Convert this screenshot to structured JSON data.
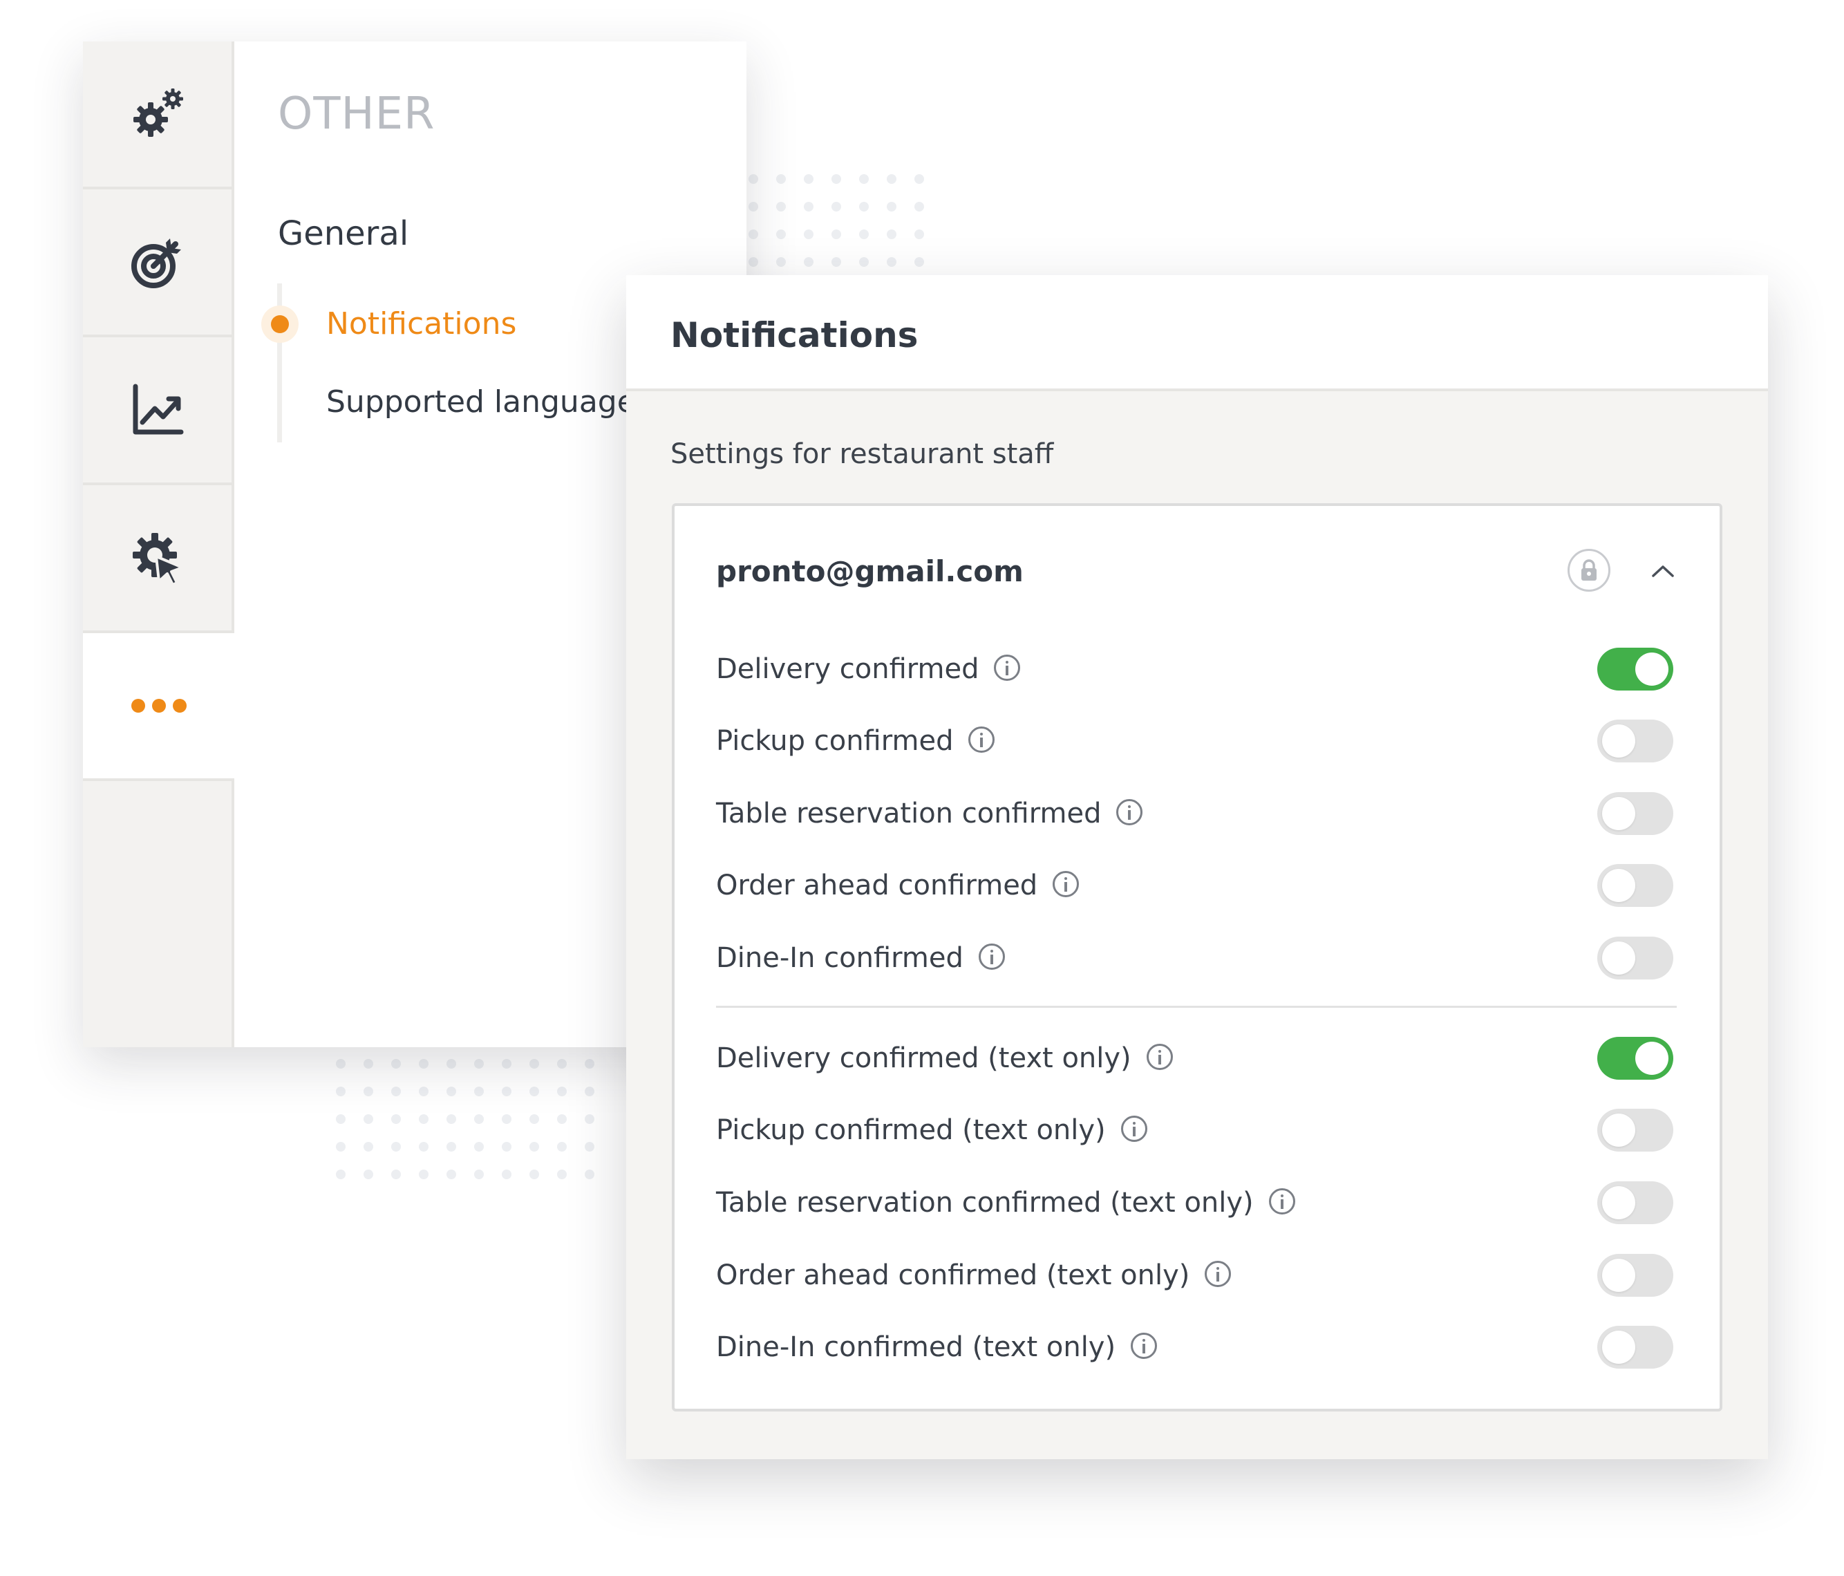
{
  "sidebar": {
    "section_title": "OTHER",
    "rail_icons": [
      "gears-icon",
      "target-icon",
      "chart-line-icon",
      "gear-cursor-icon",
      "more-icon"
    ],
    "group_label": "General",
    "items": [
      {
        "label": "Notifications",
        "active": true
      },
      {
        "label": "Supported languages",
        "active": false
      }
    ]
  },
  "notifications": {
    "title": "Notifications",
    "subtitle": "Settings for restaurant staff",
    "account": {
      "email": "pronto@gmail.com",
      "locked_icon": "lock-icon",
      "collapse_icon": "chevron-up-icon"
    },
    "group1": [
      {
        "label": "Delivery confirmed",
        "enabled": true
      },
      {
        "label": "Pickup confirmed",
        "enabled": false
      },
      {
        "label": "Table reservation confirmed",
        "enabled": false
      },
      {
        "label": "Order ahead confirmed",
        "enabled": false
      },
      {
        "label": "Dine-In confirmed",
        "enabled": false
      }
    ],
    "group2": [
      {
        "label": "Delivery confirmed (text only)",
        "enabled": true
      },
      {
        "label": "Pickup confirmed (text only)",
        "enabled": false
      },
      {
        "label": "Table reservation confirmed (text only)",
        "enabled": false
      },
      {
        "label": "Order ahead confirmed (text only)",
        "enabled": false
      },
      {
        "label": "Dine-In confirmed (text only)",
        "enabled": false
      }
    ]
  },
  "colors": {
    "accent": "#ef8a17",
    "toggle_on": "#42b04a",
    "toggle_off": "#e2e2e2",
    "text": "#333a44"
  }
}
